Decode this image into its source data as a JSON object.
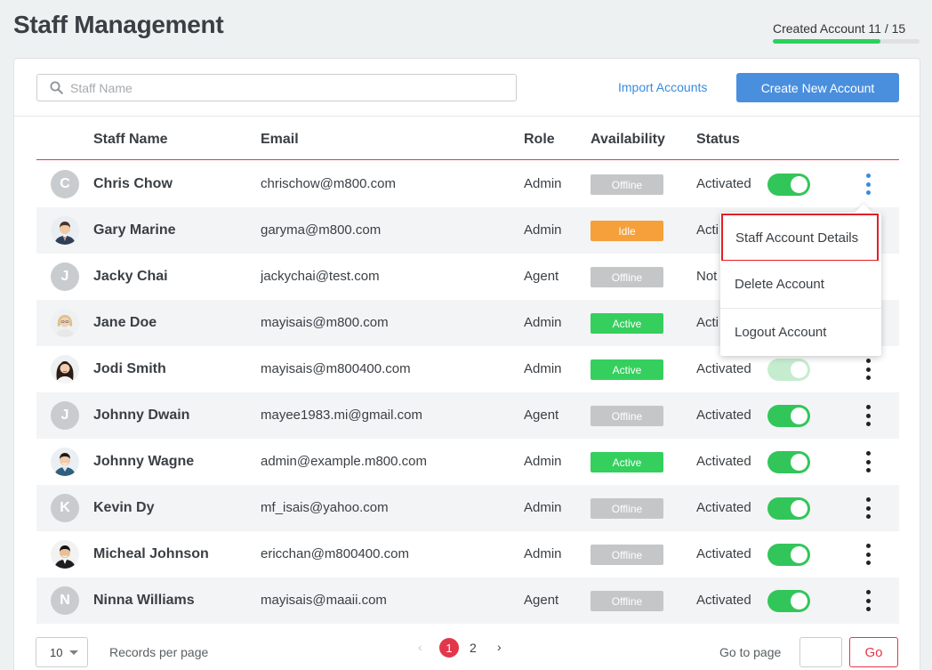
{
  "page": {
    "title": "Staff Management"
  },
  "quota": {
    "label": "Created Account 11 / 15",
    "used": 11,
    "total": 15
  },
  "toolbar": {
    "search_placeholder": "Staff Name",
    "import_label": "Import Accounts",
    "create_label": "Create New Account"
  },
  "table": {
    "headers": {
      "name": "Staff Name",
      "email": "Email",
      "role": "Role",
      "availability": "Availability",
      "status": "Status"
    },
    "rows": [
      {
        "initial": "C",
        "avatar": "initial",
        "name": "Chris Chow",
        "email": "chrischow@m800.com",
        "role": "Admin",
        "availability": "Offline",
        "status": "Activated"
      },
      {
        "initial": "",
        "avatar": "photo-man-suit",
        "name": "Gary Marine",
        "email": "garyma@m800.com",
        "role": "Admin",
        "availability": "Idle",
        "status": "Acti"
      },
      {
        "initial": "J",
        "avatar": "initial",
        "name": "Jacky Chai",
        "email": "jackychai@test.com",
        "role": "Agent",
        "availability": "Offline",
        "status": "Not"
      },
      {
        "initial": "",
        "avatar": "photo-woman-blonde",
        "name": "Jane Doe",
        "email": "mayisais@m800.com",
        "role": "Admin",
        "availability": "Active",
        "status": "Acti"
      },
      {
        "initial": "",
        "avatar": "photo-woman-dark-hair",
        "name": "Jodi Smith",
        "email": "mayisais@m800400.com",
        "role": "Admin",
        "availability": "Active",
        "status": "Activated"
      },
      {
        "initial": "J",
        "avatar": "initial",
        "name": "Johnny Dwain",
        "email": "mayee1983.mi@gmail.com",
        "role": "Agent",
        "availability": "Offline",
        "status": "Activated"
      },
      {
        "initial": "",
        "avatar": "photo-man-light-shirt",
        "name": "Johnny Wagne",
        "email": "admin@example.m800.com",
        "role": "Admin",
        "availability": "Active",
        "status": "Activated"
      },
      {
        "initial": "K",
        "avatar": "initial",
        "name": "Kevin Dy",
        "email": "mf_isais@yahoo.com",
        "role": "Admin",
        "availability": "Offline",
        "status": "Activated"
      },
      {
        "initial": "",
        "avatar": "photo-man-dark-suit",
        "name": "Micheal Johnson",
        "email": "ericchan@m800400.com",
        "role": "Admin",
        "availability": "Offline",
        "status": "Activated"
      },
      {
        "initial": "N",
        "avatar": "initial",
        "name": "Ninna Williams",
        "email": "mayisais@maaii.com",
        "role": "Agent",
        "availability": "Offline",
        "status": "Activated"
      }
    ]
  },
  "availability_colors": {
    "Offline": "#c4c6c8",
    "Idle": "#f5a03a",
    "Active": "#35cf5e"
  },
  "dropdown": {
    "items": [
      "Staff Account Details",
      "Delete Account",
      "Logout Account"
    ]
  },
  "pagination": {
    "per_page_value": "10",
    "per_page_label": "Records per page",
    "prev": "‹",
    "pages": [
      "1",
      "2"
    ],
    "current": "1",
    "next": "›",
    "goto_label": "Go to page",
    "go_label": "Go"
  }
}
